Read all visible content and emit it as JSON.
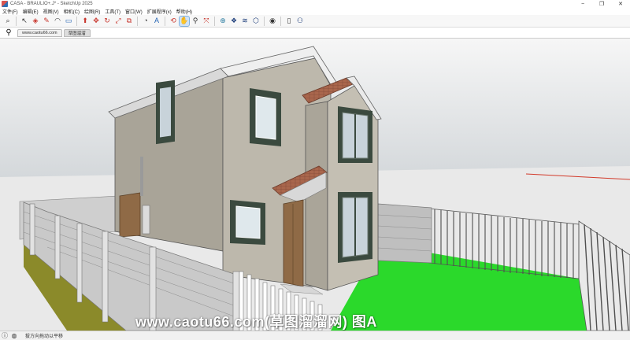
{
  "window": {
    "title": "CASA - BRAULIO+.J* - SketchUp 2025",
    "controls": [
      "−",
      "❐",
      "✕"
    ]
  },
  "menu": [
    "文件(F)",
    "编辑(E)",
    "视图(V)",
    "相机(C)",
    "绘图(R)",
    "工具(T)",
    "窗口(W)",
    "扩展程序(x)",
    "帮助(H)"
  ],
  "toolbar": {
    "tools": [
      {
        "icon": "search-icon",
        "glyph": "⌕"
      },
      {
        "icon": "select-arrow-icon",
        "glyph": "↖"
      },
      {
        "icon": "eraser-icon",
        "glyph": "◈"
      },
      {
        "icon": "pencil-icon",
        "glyph": "✎"
      },
      {
        "icon": "arc-icon",
        "glyph": "◠"
      },
      {
        "icon": "rectangle-icon",
        "glyph": "▭"
      },
      {
        "icon": "push-pull-icon",
        "glyph": "⬆"
      },
      {
        "icon": "move-icon",
        "glyph": "✥"
      },
      {
        "icon": "rotate-icon",
        "glyph": "↻"
      },
      {
        "icon": "scale-icon",
        "glyph": "⤢"
      },
      {
        "icon": "offset-icon",
        "glyph": "⧉"
      },
      {
        "icon": "tape-measure-icon",
        "glyph": "◔"
      },
      {
        "icon": "text-icon",
        "glyph": "A"
      },
      {
        "icon": "orbit-icon",
        "glyph": "⟲"
      },
      {
        "icon": "pan-icon",
        "glyph": "✋"
      },
      {
        "icon": "zoom-icon",
        "glyph": "⚲"
      },
      {
        "icon": "zoom-extents-icon",
        "glyph": "⤧"
      },
      {
        "icon": "warehouse-icon",
        "glyph": "⊕"
      },
      {
        "icon": "components-icon",
        "glyph": "❖"
      },
      {
        "icon": "layers-icon",
        "glyph": "≋"
      },
      {
        "icon": "extension-icon",
        "glyph": "⬡"
      },
      {
        "icon": "profile-icon",
        "glyph": "◉"
      },
      {
        "icon": "new-file-icon",
        "glyph": "▯"
      },
      {
        "icon": "user-icon",
        "glyph": "⚇"
      }
    ]
  },
  "scenes": {
    "tabs": [
      "www.caotu66.com",
      "草图溜溜"
    ]
  },
  "watermark": "www.caotu66.com(草图溜溜网) 图A",
  "status": {
    "text": "拔方向拖动以平移"
  },
  "colors": {
    "sky_top": "#f4f4f4",
    "sky_bottom": "#d6dadd",
    "ground": "#e9e9e9",
    "lawn": "#2bd92b",
    "wall_light": "#bdb8ac",
    "wall_dark": "#a9a498",
    "roof_tile": "#a9664c",
    "window_frame": "#3b4a3f",
    "soil": "#8b8a2a"
  }
}
